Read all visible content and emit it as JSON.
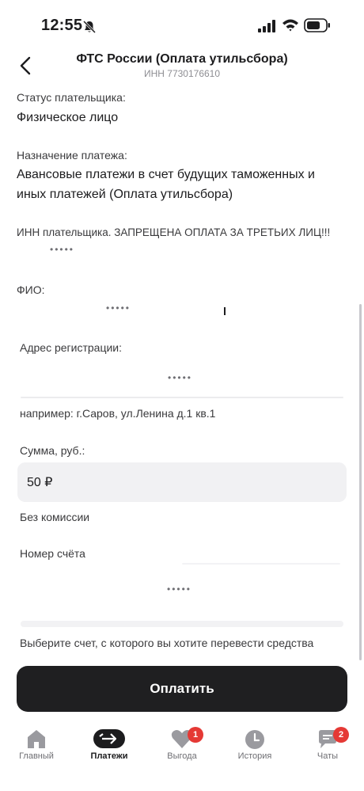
{
  "status_bar": {
    "time": "12:55"
  },
  "header": {
    "title": "ФТС России (Оплата утильсбора)",
    "subtitle": "ИНН 7730176610"
  },
  "form": {
    "payer_status_label": "Статус плательщика:",
    "payer_status_value": "Физическое лицо",
    "purpose_label": "Назначение платежа:",
    "purpose_value_line1": "Авансовые платежи в счет будущих таможенных и",
    "purpose_value_line2": "иных платежей (Оплата утильсбора)",
    "inn_label": "ИНН плательщика. ЗАПРЕЩЕНА ОПЛАТА ЗА ТРЕТЬИХ ЛИЦ!!!",
    "inn_value": "•••••",
    "fio_label": "ФИО:",
    "fio_value": "•••••",
    "address_label": "Адрес регистрации:",
    "address_value": "•••••",
    "address_hint": "например: г.Саров, ул.Ленина д.1 кв.1",
    "amount_label": "Сумма, руб.:",
    "amount_value": "50 ₽",
    "amount_hint": "Без комиссии",
    "account_label": "Номер счёта",
    "account_value": "•••••",
    "account_hint": "Выберите счет, с которого вы хотите перевести средства"
  },
  "pay_button": {
    "label": "Оплатить"
  },
  "tabs": [
    {
      "label": "Главный",
      "icon": "home-icon",
      "active": false
    },
    {
      "label": "Платежи",
      "icon": "transfer-icon",
      "active": true
    },
    {
      "label": "Выгода",
      "icon": "heart-icon",
      "active": false,
      "badge": "1"
    },
    {
      "label": "История",
      "icon": "clock-icon",
      "active": false
    },
    {
      "label": "Чаты",
      "icon": "chat-icon",
      "active": false,
      "badge": "2"
    }
  ],
  "colors": {
    "accent_dark": "#1f1f21",
    "badge": "#e53935",
    "field_bg": "#f1f1f3",
    "icon_gray": "#9a9a9f"
  }
}
